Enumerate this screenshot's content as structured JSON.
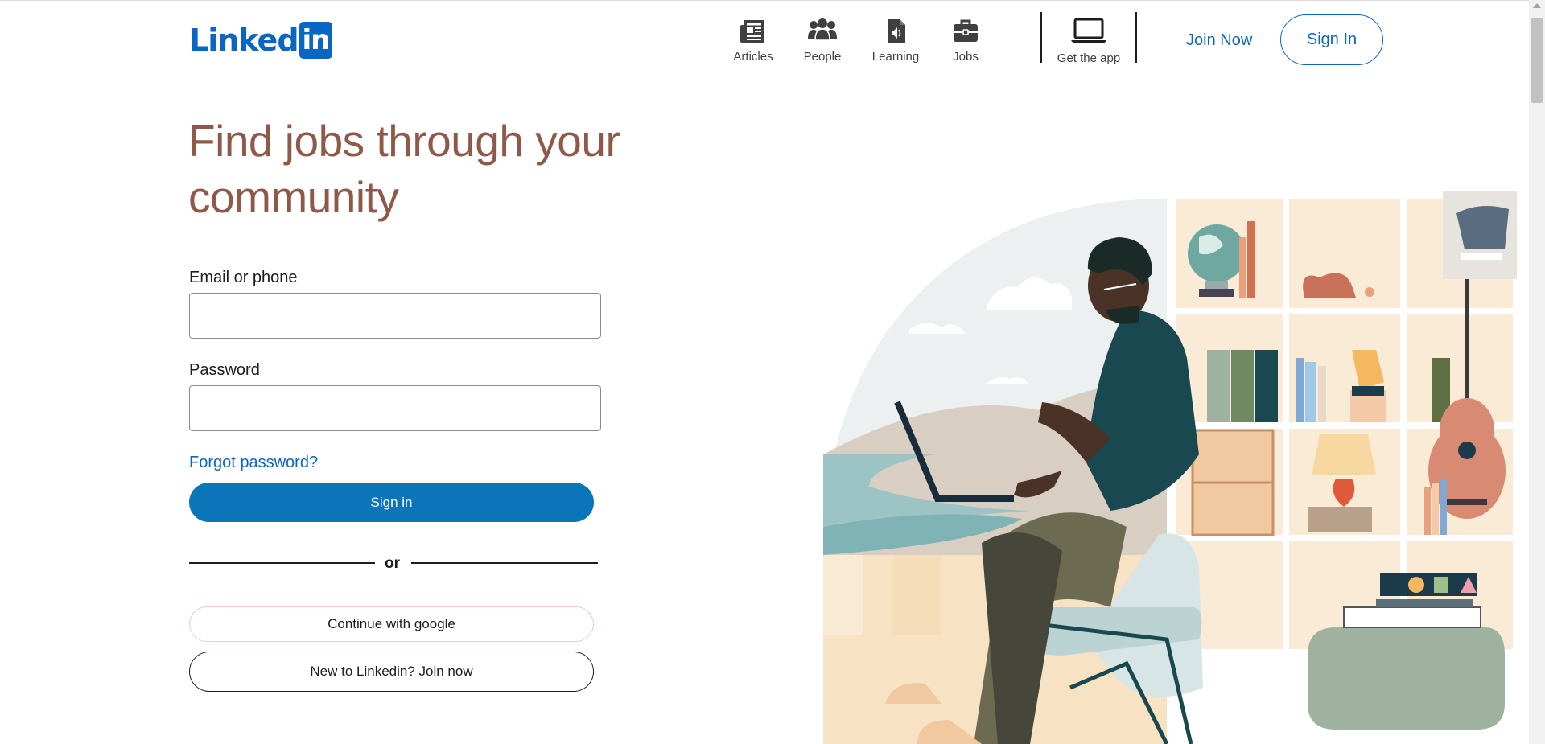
{
  "brand": {
    "name_part": "Linked",
    "box_part": "in",
    "color": "#0a66c2"
  },
  "nav": {
    "items": [
      {
        "label": "Articles",
        "icon": "newspaper-icon"
      },
      {
        "label": "People",
        "icon": "people-icon"
      },
      {
        "label": "Learning",
        "icon": "learning-icon"
      },
      {
        "label": "Jobs",
        "icon": "briefcase-icon"
      }
    ],
    "get_app": {
      "label": "Get the app",
      "icon": "laptop-icon"
    }
  },
  "header": {
    "join_now": "Join Now",
    "sign_in": "Sign In"
  },
  "hero": {
    "headline": "Find jobs through your community",
    "headline_color": "#8f5849"
  },
  "form": {
    "email_label": "Email or phone",
    "email_value": "",
    "password_label": "Password",
    "password_value": "",
    "forgot_password": "Forgot password?",
    "sign_in_button": "Sign in",
    "sign_in_color": "#0a75b8",
    "or_text": "or",
    "google_button": "Continue with google",
    "join_button": "New to Linkedin? Join now"
  }
}
